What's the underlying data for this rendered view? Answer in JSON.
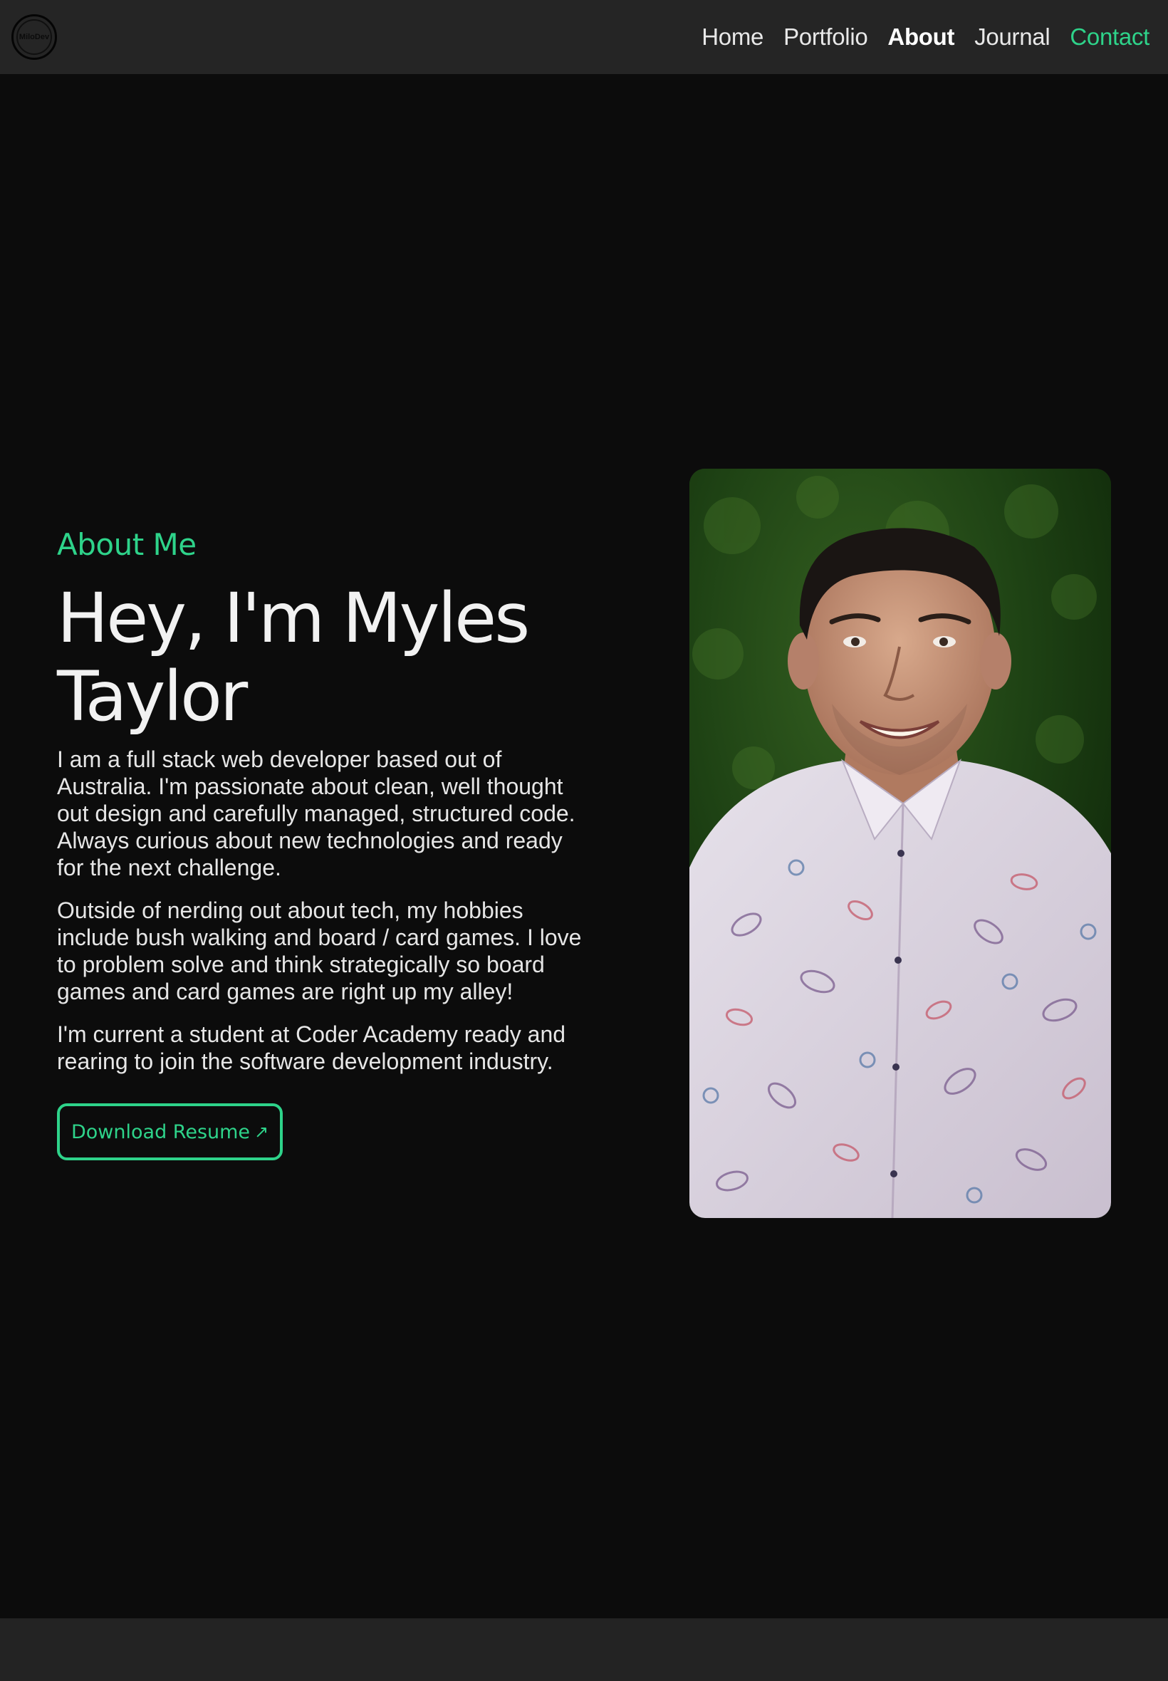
{
  "nav": {
    "logo_text": "MiloDev",
    "links": [
      {
        "label": "Home"
      },
      {
        "label": "Portfolio"
      },
      {
        "label": "About"
      },
      {
        "label": "Journal"
      },
      {
        "label": "Contact"
      }
    ],
    "active": "About"
  },
  "about": {
    "kicker": "About Me",
    "headline_line1": "Hey, I'm Myles",
    "headline_line2": "Taylor",
    "paragraphs": [
      "I am a full stack web developer based out of Australia. I'm passionate about clean, well thought out design and carefully managed, structured code. Always curious about new technologies and ready for the next challenge.",
      "Outside of nerding out about tech, my hobbies include bush walking and board / card games. I love to problem solve and think strategically so board games and card games are right up my alley!",
      "I'm current a student at Coder Academy ready and rearing to join the software development industry."
    ],
    "button_label": "Download Resume",
    "button_icon": "arrow-up-right-icon"
  },
  "colors": {
    "accent": "#2ed38a",
    "background": "#0c0c0c",
    "navbar": "#252525",
    "footer": "#232323"
  }
}
